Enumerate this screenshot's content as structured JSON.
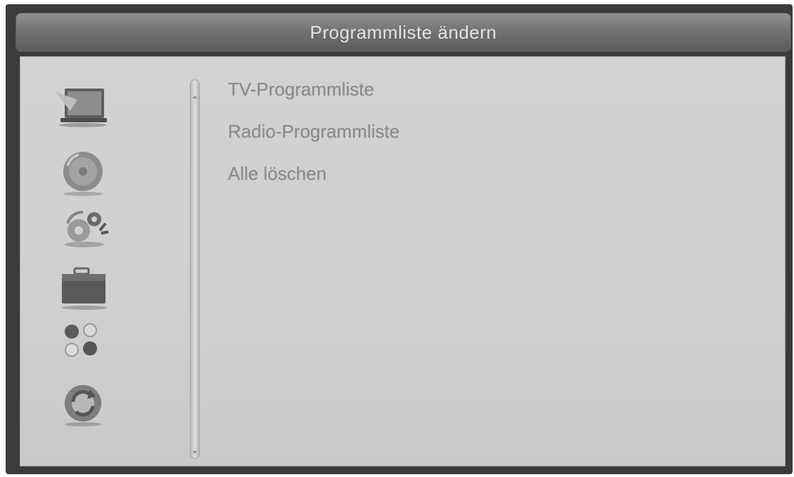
{
  "title": "Programmliste ändern",
  "menu_icons": [
    {
      "name": "tv-icon"
    },
    {
      "name": "disc-icon"
    },
    {
      "name": "settings-gears-icon"
    },
    {
      "name": "toolbox-icon"
    },
    {
      "name": "games-icon"
    },
    {
      "name": "refresh-icon"
    }
  ],
  "items": [
    {
      "label": "TV-Programmliste"
    },
    {
      "label": "Radio-Programmliste"
    },
    {
      "label": "Alle löschen"
    }
  ]
}
